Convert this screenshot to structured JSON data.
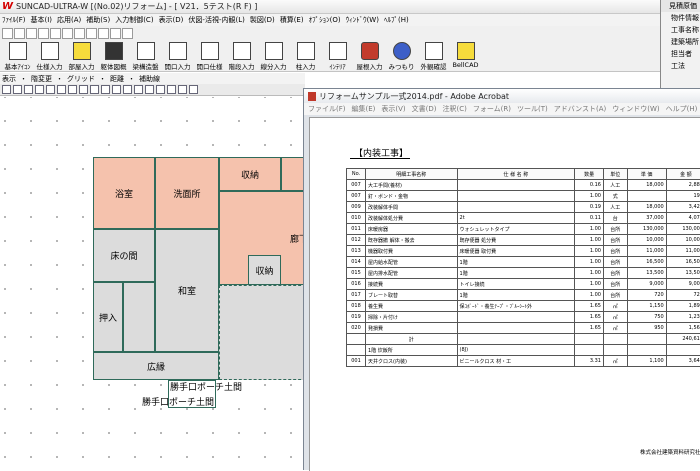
{
  "cad": {
    "title": "SUNCAD-ULTRA-W [(No.02)リフォーム] - [ V21．5テスト(R F) ]",
    "menu": [
      "ﾌｧｲﾙ(F)",
      "基本(I)",
      "応用(A)",
      "補助(S)",
      "入力制御(C)",
      "表示(D)",
      "伏図-活視-内観(L)",
      "製図(D)",
      "積算(E)",
      "ｵﾌﾟｼｮﾝ(O)",
      "ｳｨﾝﾄﾞｳ(W)",
      "ﾍﾙﾌﾟ(H)"
    ],
    "tools": [
      {
        "label": "基本ｱｲｺﾝ",
        "icon": "arrow-icon",
        "style": ""
      },
      {
        "label": "仕様入力",
        "icon": "spec-icon",
        "style": ""
      },
      {
        "label": "部屋入力",
        "icon": "room-icon",
        "style": "yellow"
      },
      {
        "label": "躯体図概",
        "icon": "frame-icon",
        "style": "dark"
      },
      {
        "label": "梁構造盤",
        "icon": "beam-icon",
        "style": ""
      },
      {
        "label": "開口入力",
        "icon": "opening-icon",
        "style": ""
      },
      {
        "label": "開口仕様",
        "icon": "opening-spec-icon",
        "style": ""
      },
      {
        "label": "階段入力",
        "icon": "stairs-icon",
        "style": ""
      },
      {
        "label": "線分入力",
        "icon": "line-icon",
        "style": ""
      },
      {
        "label": "柱入力",
        "icon": "column-icon",
        "style": ""
      },
      {
        "label": "ｲﾝﾃﾘｱ",
        "icon": "interior-icon",
        "style": ""
      },
      {
        "label": "屋根入力",
        "icon": "roof-icon",
        "style": "red"
      },
      {
        "label": "みつもり",
        "icon": "estimate-icon",
        "style": "blue"
      },
      {
        "label": "外観確認",
        "icon": "exterior-icon",
        "style": ""
      },
      {
        "label": "BellCAD",
        "icon": "bell-icon",
        "style": "yellow"
      }
    ],
    "submenu": [
      "表示",
      "・",
      "階変更",
      "・",
      "グリッド",
      "・",
      "距離",
      "・",
      "補助線"
    ],
    "rooms": {
      "bath": "浴室",
      "washroom": "洗面所",
      "storage1": "収納",
      "corridor": "廊下",
      "storage2": "収納",
      "tokonoma": "床の間",
      "washitsu": "和室",
      "oshiire": "押入",
      "engawa": "広縁"
    },
    "labels": {
      "porch1": "勝手口ポーチ土間",
      "porch2": "勝手口ポーチ土間"
    }
  },
  "info": {
    "title": "見積原価",
    "rows": [
      "物件情報",
      "工事名称",
      "建築場所",
      "担当者",
      "工法"
    ]
  },
  "acrobat": {
    "title": "リフォームサンプル一式2014.pdf - Adobe Acrobat",
    "menu": [
      "ファイル(F)",
      "編集(E)",
      "表示(V)",
      "文書(D)",
      "注釈(C)",
      "フォーム(R)",
      "ツール(T)",
      "アドバンスト(A)",
      "ウィンドウ(W)",
      "ヘルプ(H)"
    ],
    "doc": {
      "heading": "【内装工事】",
      "columns": [
        "No.",
        "明細工事名称",
        "仕 様 名 称",
        "数量",
        "単位",
        "単 価",
        "金 額"
      ],
      "rows": [
        [
          "007",
          "大工手間(養材)",
          "",
          "0.16",
          "人工",
          "18,000",
          "2,880"
        ],
        [
          "007",
          "釘・ボンド・金物",
          "",
          "1.00",
          "式",
          "",
          "198"
        ],
        [
          "009",
          "改装解体手間",
          "",
          "0.19",
          "人工",
          "18,000",
          "3,420"
        ],
        [
          "010",
          "改装解体処分費",
          "2t",
          "0.11",
          "台",
          "37,000",
          "4,070"
        ],
        [
          "011",
          "床暖房器",
          "ウォシュレットタイプ",
          "1.00",
          "台所",
          "130,000",
          "130,000"
        ],
        [
          "012",
          "既存器撤 解体・搬去",
          "既存便器 処分費",
          "1.00",
          "台所",
          "10,000",
          "10,000"
        ],
        [
          "013",
          "機器取付費",
          "床暖便器 取付費",
          "1.00",
          "台所",
          "11,000",
          "11,000"
        ],
        [
          "014",
          "屋内給水配管",
          "1階",
          "1.00",
          "台所",
          "16,500",
          "16,500"
        ],
        [
          "015",
          "屋内排水配管",
          "1階",
          "1.00",
          "台所",
          "13,500",
          "13,500"
        ],
        [
          "016",
          "接続費",
          "トイレ接続",
          "1.00",
          "台所",
          "9,000",
          "9,000"
        ],
        [
          "017",
          "ブレート取替",
          "1階",
          "1.00",
          "台所",
          "720",
          "720"
        ],
        [
          "018",
          "養生費",
          "保ｺﾎﾞｰﾄﾞ・養生ﾃｰﾌﾟ・ﾌﾞﾙｰｼｰﾄ外",
          "1.65",
          "㎡",
          "1,150",
          "1,897"
        ],
        [
          "019",
          "掃除・片付け",
          "",
          "1.65",
          "㎡",
          "750",
          "1,237"
        ],
        [
          "020",
          "発損費",
          "",
          "1.65",
          "㎡",
          "950",
          "1,567"
        ]
      ],
      "subtotal_label": "計",
      "subtotal": "240,610",
      "section_no": "",
      "section_name": "1階 炊飯所",
      "section_spec": "(8J)",
      "last_row": [
        "001",
        "天井クロス(内装)",
        "ビニールクロス 材・工",
        "3.31",
        "㎡",
        "1,100",
        "3,641"
      ],
      "company": "株式会社建築資料研究社"
    }
  }
}
